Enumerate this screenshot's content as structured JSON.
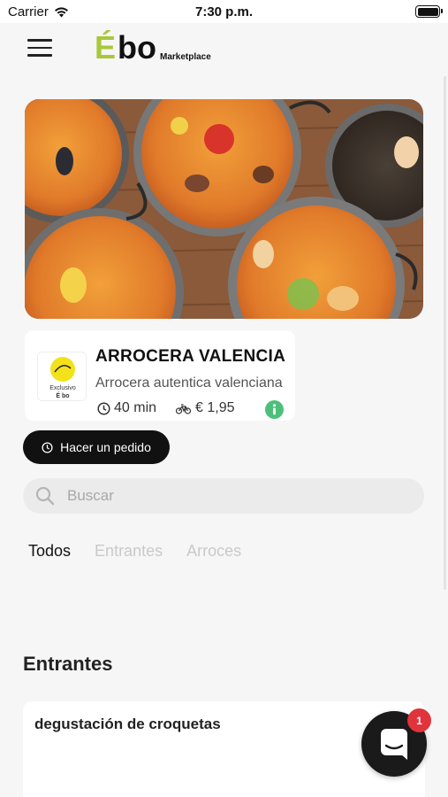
{
  "status_bar": {
    "carrier": "Carrier",
    "time": "7:30 p.m."
  },
  "header": {
    "logo_e": "É",
    "logo_bo": "bo",
    "logo_sub": "Marketplace"
  },
  "store": {
    "name": "ARROCERA VALENCIA",
    "description": "Arrocera autentica valenciana",
    "delivery_time": "40 min",
    "delivery_fee": "€ 1,95",
    "logo_line1": "Exclusivo",
    "logo_line2": "É bo"
  },
  "order_button": {
    "label": "Hacer un pedido"
  },
  "search": {
    "placeholder": "Buscar"
  },
  "tabs": [
    {
      "label": "Todos"
    },
    {
      "label": "Entrantes"
    },
    {
      "label": "Arroces"
    }
  ],
  "section": {
    "title": "Entrantes"
  },
  "products": [
    {
      "name": "degustación de croquetas"
    }
  ],
  "chat": {
    "badge_count": "1"
  },
  "colors": {
    "brand_green": "#a8c83a",
    "info_green": "#4cc07a",
    "badge_red": "#e0333b"
  }
}
